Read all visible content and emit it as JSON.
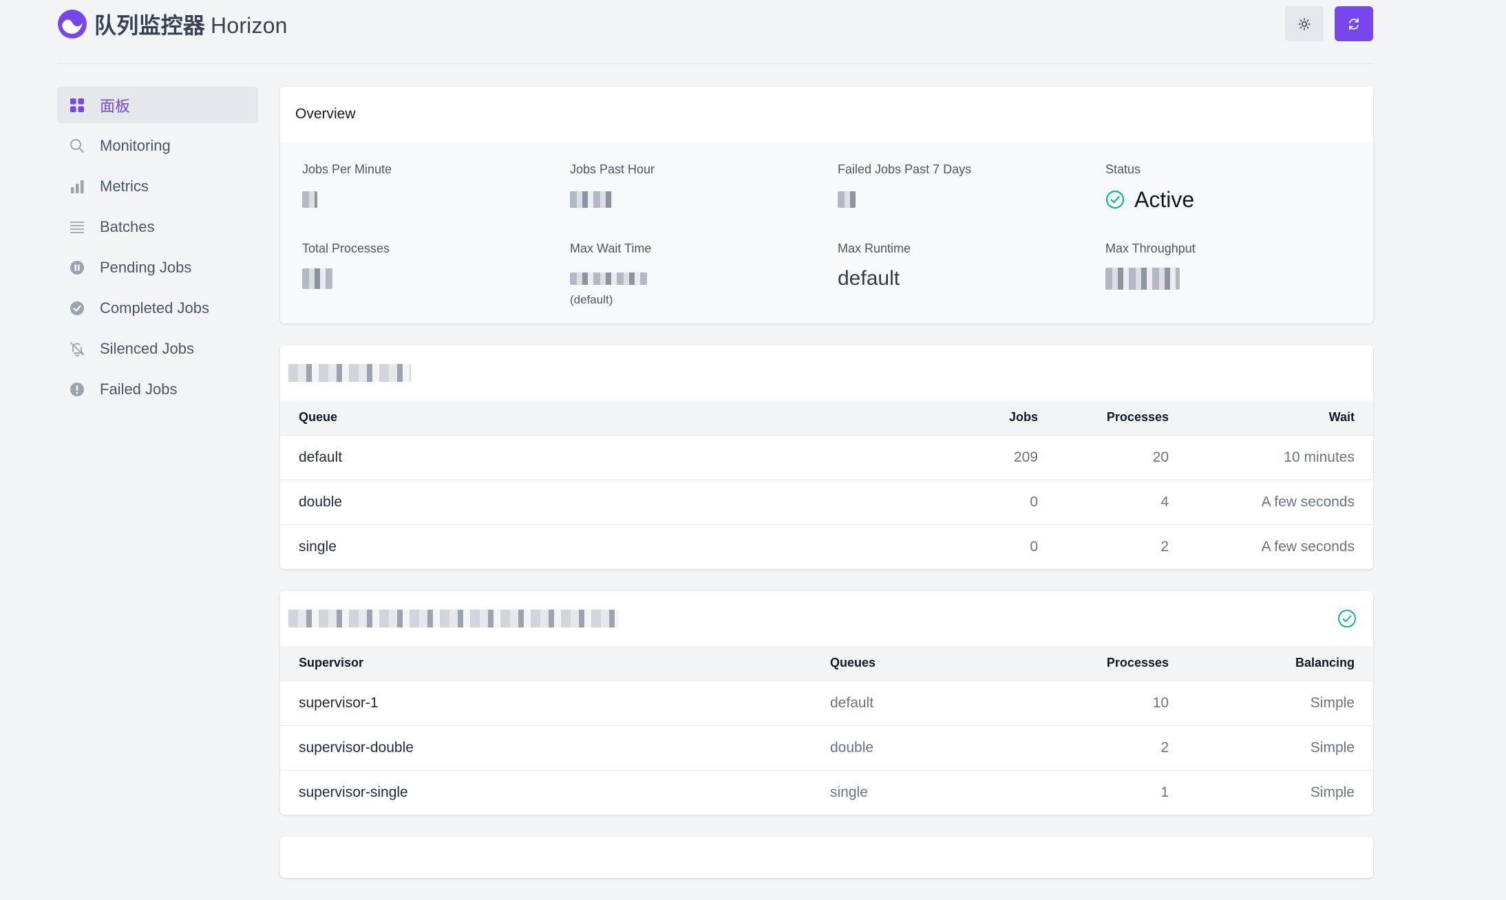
{
  "header": {
    "title_cn": "队列监控器",
    "title_en": "Horizon",
    "brand_color": "#7746ec",
    "theme_button_icon": "sun-icon",
    "refresh_button_icon": "refresh-icon"
  },
  "sidebar": {
    "items": [
      {
        "label": "面板",
        "icon": "dashboard-grid-icon",
        "active": true
      },
      {
        "label": "Monitoring",
        "icon": "search-icon"
      },
      {
        "label": "Metrics",
        "icon": "bar-chart-icon"
      },
      {
        "label": "Batches",
        "icon": "list-icon"
      },
      {
        "label": "Pending Jobs",
        "icon": "pause-circle-icon"
      },
      {
        "label": "Completed Jobs",
        "icon": "check-circle-icon"
      },
      {
        "label": "Silenced Jobs",
        "icon": "bell-slash-icon"
      },
      {
        "label": "Failed Jobs",
        "icon": "exclamation-circle-icon"
      }
    ]
  },
  "overview": {
    "title": "Overview",
    "stats": {
      "jobs_per_minute": {
        "label": "Jobs Per Minute"
      },
      "jobs_past_hour": {
        "label": "Jobs Past Hour"
      },
      "failed_jobs": {
        "label": "Failed Jobs Past 7 Days"
      },
      "status": {
        "label": "Status",
        "value": "Active"
      },
      "total_processes": {
        "label": "Total Processes"
      },
      "max_wait_time": {
        "label": "Max Wait Time",
        "sub": "(default)"
      },
      "max_runtime": {
        "label": "Max Runtime",
        "value": "default"
      },
      "max_throughput": {
        "label": "Max Throughput"
      }
    }
  },
  "queues": {
    "columns": [
      "Queue",
      "Jobs",
      "Processes",
      "Wait"
    ],
    "rows": [
      {
        "queue": "default",
        "jobs": "209",
        "processes": "20",
        "wait": "10 minutes"
      },
      {
        "queue": "double",
        "jobs": "0",
        "processes": "4",
        "wait": "A few seconds"
      },
      {
        "queue": "single",
        "jobs": "0",
        "processes": "2",
        "wait": "A few seconds"
      }
    ]
  },
  "supervisors": {
    "status_icon": "check-circle-icon",
    "columns": [
      "Supervisor",
      "Queues",
      "Processes",
      "Balancing"
    ],
    "rows": [
      {
        "supervisor": "supervisor-1",
        "queues": "default",
        "processes": "10",
        "balancing": "Simple"
      },
      {
        "supervisor": "supervisor-double",
        "queues": "double",
        "processes": "2",
        "balancing": "Simple"
      },
      {
        "supervisor": "supervisor-single",
        "queues": "single",
        "processes": "1",
        "balancing": "Simple"
      }
    ]
  }
}
